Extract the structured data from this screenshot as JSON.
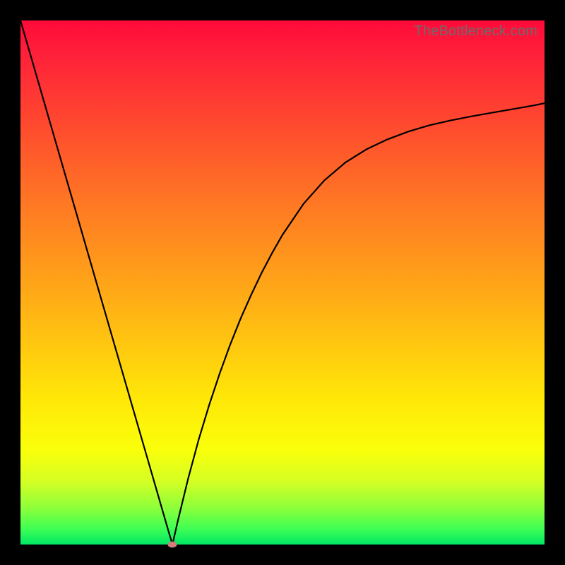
{
  "attribution": "TheBottleneck.com",
  "colors": {
    "page_bg": "#000000",
    "curve": "#000000",
    "marker": "#d87c7c",
    "gradient_stops": [
      "#ff0a3a",
      "#ff6f26",
      "#ffe708",
      "#00e765"
    ]
  },
  "chart_data": {
    "type": "line",
    "title": "",
    "xlabel": "",
    "ylabel": "",
    "xlim": [
      0,
      100
    ],
    "ylim": [
      0,
      100
    ],
    "grid": false,
    "legend": false,
    "note": "Bottleneck-style V-curve. y≈0 at x≈29 (marker). Left branch is a steep near-linear descent from (0,100) to the minimum. Right branch rises with diminishing slope, crossing roughly (50,59), (70,75), (90,82), reaching ≈85 at x=100. Values are read approximately from pixel positions; no axis ticks or numeric labels are present in the image.",
    "x": [
      0,
      2,
      4,
      6,
      8,
      10,
      12,
      14,
      16,
      18,
      20,
      22,
      24,
      26,
      28,
      29,
      30,
      32,
      34,
      36,
      38,
      40,
      42,
      44,
      46,
      48,
      50,
      54,
      58,
      62,
      66,
      70,
      74,
      78,
      82,
      86,
      90,
      94,
      98,
      100
    ],
    "y": [
      100.0,
      93.1,
      86.2,
      79.3,
      72.4,
      65.5,
      58.6,
      51.7,
      44.8,
      37.9,
      31.0,
      24.1,
      17.2,
      10.3,
      3.4,
      0.0,
      4.4,
      12.6,
      20.0,
      26.6,
      32.6,
      38.1,
      43.1,
      47.6,
      51.8,
      55.6,
      59.1,
      65.0,
      69.5,
      72.9,
      75.4,
      77.3,
      78.8,
      80.0,
      80.9,
      81.7,
      82.4,
      83.1,
      83.8,
      84.2
    ],
    "marker": {
      "x": 29,
      "y": 0
    }
  }
}
